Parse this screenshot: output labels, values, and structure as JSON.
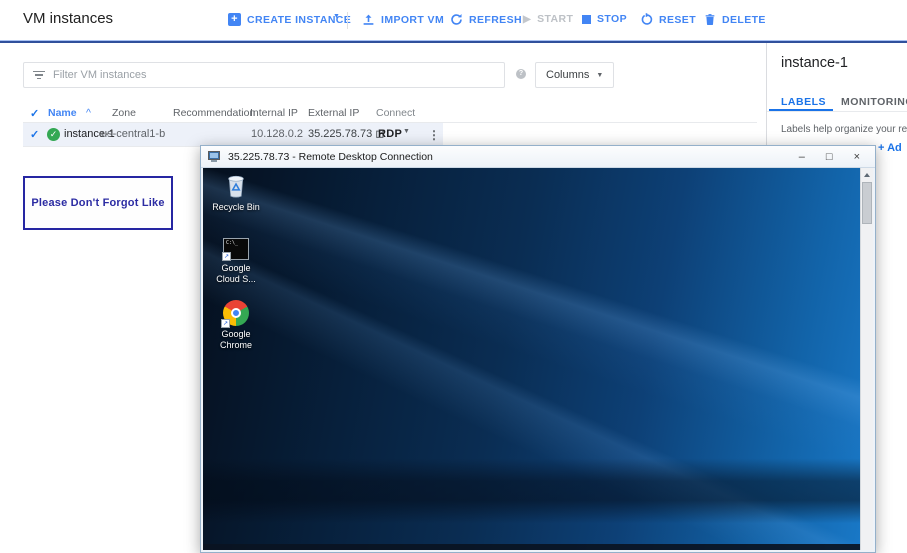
{
  "page": {
    "title": "VM instances"
  },
  "toolbar": {
    "create_instance": "CREATE INSTANCE",
    "import_vm": "IMPORT VM",
    "refresh": "REFRESH",
    "start": "START",
    "stop": "STOP",
    "reset": "RESET",
    "delete": "DELETE"
  },
  "filter_bar": {
    "placeholder": "Filter VM instances",
    "columns_button": "Columns"
  },
  "table": {
    "headers": {
      "name": "Name",
      "sort_indicator": "^",
      "zone": "Zone",
      "recommendation": "Recommendation",
      "internal_ip": "Internal IP",
      "external_ip": "External IP",
      "connect": "Connect"
    },
    "rows": [
      {
        "name": "instance-1",
        "zone": "us-central1-b",
        "recommendation": "",
        "internal_ip": "10.128.0.2",
        "external_ip": "35.225.78.73",
        "connect_option": "RDP",
        "status": "running"
      }
    ]
  },
  "note_box": {
    "text": "Please Don't Forgot Like"
  },
  "side_panel": {
    "title": "instance-1",
    "tabs": {
      "labels": "LABELS",
      "monitoring": "MONITORING"
    },
    "active_tab": "LABELS",
    "description": "Labels help organize your resourc",
    "add_label": "+ Ad"
  },
  "rdp_window": {
    "title": "35.225.78.73 - Remote Desktop Connection",
    "controls": {
      "minimize": "–",
      "maximize": "□",
      "close": "×"
    },
    "desktop_icons": [
      {
        "id": "recycle-bin",
        "label_line1": "Recycle Bin",
        "label_line2": ""
      },
      {
        "id": "google-cloud-sdk-shell",
        "label_line1": "Google",
        "label_line2": "Cloud S..."
      },
      {
        "id": "google-chrome",
        "label_line1": "Google",
        "label_line2": "Chrome"
      }
    ]
  },
  "colors": {
    "gcp_blue": "#4285f4",
    "active_tab_blue": "#1a73e8",
    "status_green": "#34a853",
    "disabled_grey": "#bdc1c6",
    "row_highlight": "#edf1f9",
    "note_border": "#2626a2",
    "wallpaper_dark": "#050f1d",
    "wallpaper_bright": "#1a7bcb"
  }
}
